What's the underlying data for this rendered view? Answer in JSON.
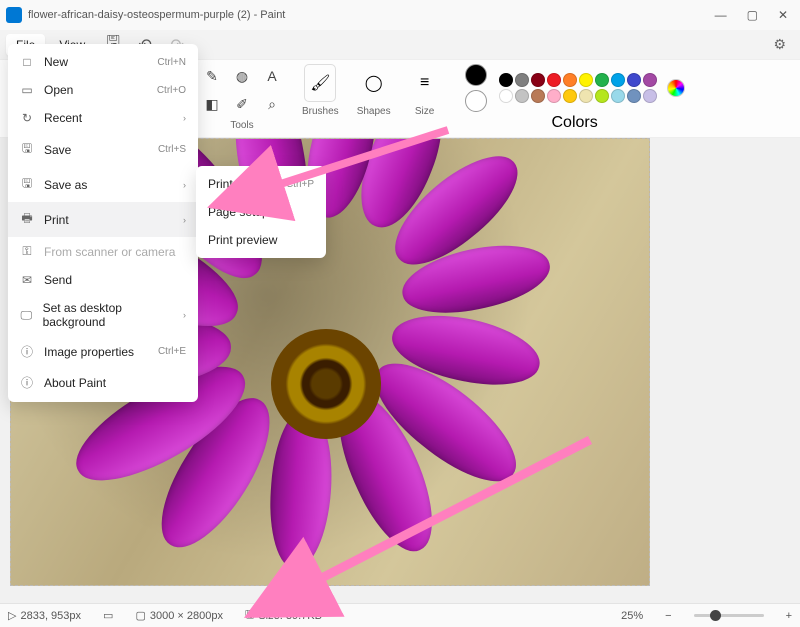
{
  "window": {
    "title": "flower-african-daisy-osteospermum-purple (2) - Paint"
  },
  "menubar": {
    "file": "File",
    "view": "View"
  },
  "ribbon": {
    "tools_label": "Tools",
    "brushes_label": "Brushes",
    "shapes_label": "Shapes",
    "size_label": "Size",
    "colors_label": "Colors"
  },
  "file_menu": {
    "items": [
      {
        "icon": "□",
        "label": "New",
        "shortcut": "Ctrl+N"
      },
      {
        "icon": "▭",
        "label": "Open",
        "shortcut": "Ctrl+O"
      },
      {
        "icon": "↻",
        "label": "Recent",
        "submenu": true
      },
      {
        "icon": "🖫",
        "label": "Save",
        "shortcut": "Ctrl+S"
      },
      {
        "icon": "🖫",
        "label": "Save as",
        "submenu": true
      },
      {
        "icon": "🖶",
        "label": "Print",
        "submenu": true,
        "hover": true
      },
      {
        "icon": "⚿",
        "label": "From scanner or camera",
        "disabled": true
      },
      {
        "icon": "✉",
        "label": "Send"
      },
      {
        "icon": "🖵",
        "label": "Set as desktop background",
        "submenu": true
      },
      {
        "icon": "ⓘ",
        "label": "Image properties",
        "shortcut": "Ctrl+E"
      },
      {
        "icon": "ⓘ",
        "label": "About Paint"
      }
    ]
  },
  "print_submenu": {
    "items": [
      {
        "label": "Print",
        "shortcut": "Ctrl+P"
      },
      {
        "label": "Page setup"
      },
      {
        "label": "Print preview"
      }
    ]
  },
  "swatches_row1": [
    "#000000",
    "#7f7f7f",
    "#880015",
    "#ed1c24",
    "#ff7f27",
    "#fff200",
    "#22b14c",
    "#00a2e8",
    "#3f48cc",
    "#a349a4"
  ],
  "swatches_row2": [
    "#ffffff",
    "#c3c3c3",
    "#b97a57",
    "#ffaec9",
    "#ffc90e",
    "#efe4b0",
    "#b5e61d",
    "#99d9ea",
    "#7092be",
    "#c8bfe7"
  ],
  "status": {
    "cursor": "2833, 953px",
    "dimensions": "3000 × 2800px",
    "size_label": "Size: 39.7KB",
    "zoom": "25%"
  }
}
